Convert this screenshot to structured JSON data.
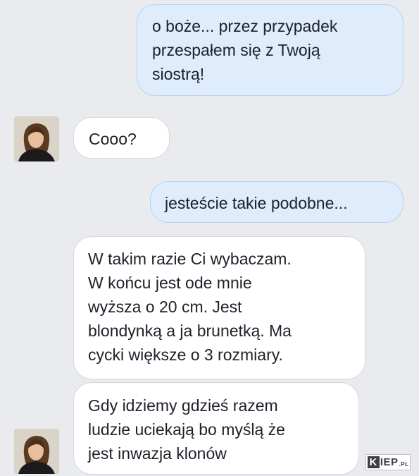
{
  "conversation": {
    "messages": [
      {
        "direction": "outgoing",
        "text": "o boże... przez przypadek\nprzespałem się z Twoją\nsiostrą!"
      },
      {
        "direction": "incoming",
        "text": "Cooo?"
      },
      {
        "direction": "outgoing",
        "text": "jesteście takie podobne..."
      },
      {
        "direction": "incoming",
        "text": "W takim razie Ci wybaczam.\nW końcu jest ode mnie\nwyższa o 20 cm. Jest\nblondynką a ja brunetką. Ma\ncycki większe o 3 rozmiary."
      },
      {
        "direction": "incoming",
        "text": "Gdy idziemy gdzieś razem\nludzie uciekają bo myślą że\njest inwazja klonów"
      }
    ]
  },
  "watermark": {
    "first_letter": "K",
    "rest": "IEP",
    "tld": ".PL"
  },
  "colors": {
    "background": "#e9ebee",
    "outgoing_bubble": "#deecfc",
    "outgoing_border": "#b8d3f3",
    "incoming_bubble": "#ffffff",
    "incoming_border": "#d4d7dc",
    "text": "#1d2129"
  },
  "icons": {
    "contact_avatar": "contact-avatar"
  }
}
